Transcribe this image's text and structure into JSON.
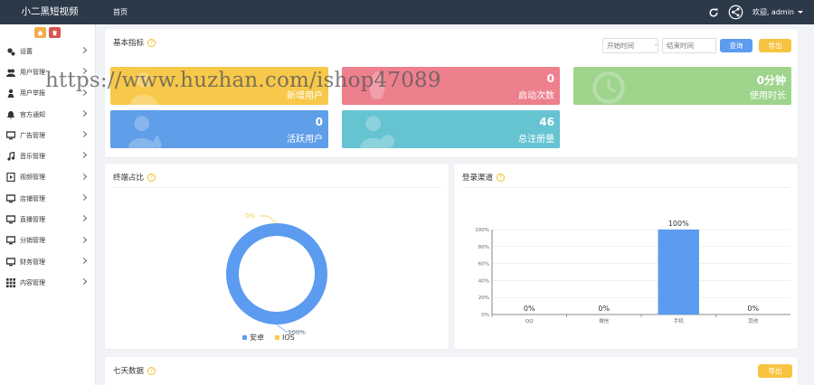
{
  "app": {
    "title": "小二黑短视频",
    "breadcrumb": "首页",
    "welcome": "欢迎, admin"
  },
  "sidebar": {
    "items": [
      {
        "label": "设置",
        "icon": "gears-icon"
      },
      {
        "label": "用户管理",
        "icon": "users-icon"
      },
      {
        "label": "用户举报",
        "icon": "user-report-icon"
      },
      {
        "label": "官方通知",
        "icon": "bell-icon"
      },
      {
        "label": "广告管理",
        "icon": "monitor-icon"
      },
      {
        "label": "音乐管理",
        "icon": "music-icon"
      },
      {
        "label": "视频管理",
        "icon": "video-icon"
      },
      {
        "label": "店铺管理",
        "icon": "monitor-icon"
      },
      {
        "label": "直播管理",
        "icon": "monitor-icon"
      },
      {
        "label": "分销管理",
        "icon": "monitor-icon"
      },
      {
        "label": "财务管理",
        "icon": "monitor-icon"
      },
      {
        "label": "内容管理",
        "icon": "grid-icon"
      }
    ]
  },
  "metrics": {
    "title": "基本指标",
    "start_placeholder": "开始时间",
    "separator": "-",
    "end_placeholder": "结束时间",
    "query_label": "查询",
    "export_label": "导出",
    "stats": [
      {
        "value": "",
        "label": "新增用户",
        "color": "#f7c84a"
      },
      {
        "value": "0",
        "label": "启动次数",
        "color": "#ee7f8d"
      },
      {
        "value": "0分钟",
        "label": "使用时长",
        "color": "#9fd48d"
      },
      {
        "value": "0",
        "label": "活跃用户",
        "color": "#5f9ee8"
      },
      {
        "value": "46",
        "label": "总注册量",
        "color": "#66c3d1"
      }
    ]
  },
  "watermark": "https://www.huzhan.com/ishop47089",
  "terminal": {
    "title": "终端占比",
    "chart_data": {
      "type": "pie",
      "labels": [
        "安卓",
        "IOS"
      ],
      "values": [
        100,
        0
      ],
      "data_labels": [
        "100%",
        "0%"
      ],
      "colors": [
        "#5b9bf0",
        "#f7c84a"
      ],
      "legend": "bottom"
    }
  },
  "login": {
    "title": "登录渠道",
    "chart_data": {
      "type": "bar",
      "categories": [
        "QQ",
        "微信",
        "手机",
        "其他"
      ],
      "values": [
        0,
        0,
        100,
        0
      ],
      "data_labels": [
        "0%",
        "0%",
        "100%",
        "0%"
      ],
      "y_ticks": [
        "0%",
        "20%",
        "40%",
        "60%",
        "80%",
        "100%"
      ],
      "ylim": [
        0,
        100
      ],
      "color": "#5b9bf0",
      "grid": true
    }
  },
  "week": {
    "title": "七天数据",
    "export_label": "导出"
  }
}
